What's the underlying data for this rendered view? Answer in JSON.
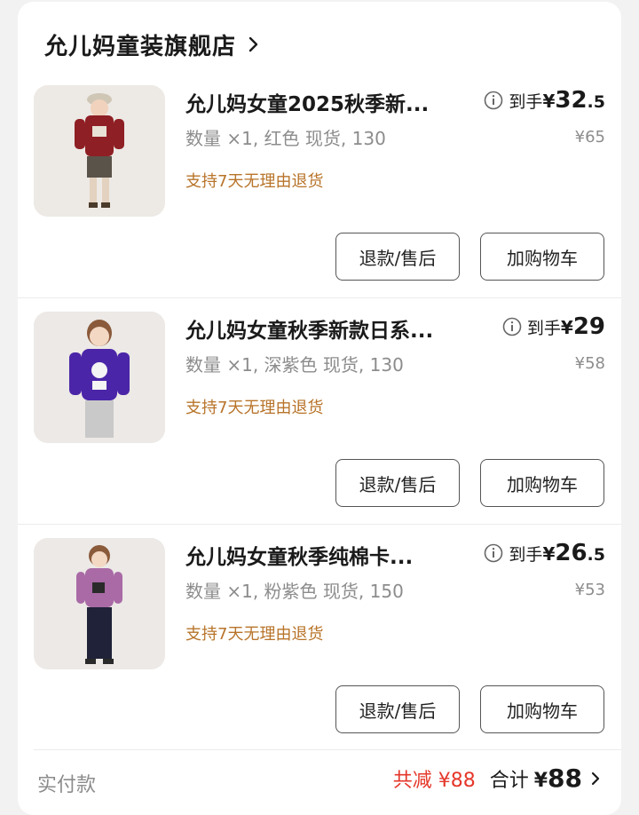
{
  "shop": {
    "name": "允儿妈童装旗舰店"
  },
  "items": [
    {
      "title": "允儿妈女童2025秋季新...",
      "specs": "数量 ×1, 红色 现货, 130",
      "policy": "支持7天无理由退货",
      "price_label": "到手",
      "price_currency": "¥",
      "price_int": "32",
      "price_dec": ".5",
      "original_price": "¥65",
      "refund_label": "退款/售后",
      "cart_label": "加购物车",
      "sweater_color": "#8e1f24"
    },
    {
      "title": "允儿妈女童秋季新款日系...",
      "specs": "数量 ×1, 深紫色 现货, 130",
      "policy": "支持7天无理由退货",
      "price_label": "到手",
      "price_currency": "¥",
      "price_int": "29",
      "price_dec": "",
      "original_price": "¥58",
      "refund_label": "退款/售后",
      "cart_label": "加购物车",
      "sweater_color": "#4b25a8"
    },
    {
      "title": "允儿妈女童秋季纯棉卡...",
      "specs": "数量 ×1, 粉紫色 现货, 150",
      "policy": "支持7天无理由退货",
      "price_label": "到手",
      "price_currency": "¥",
      "price_int": "26",
      "price_dec": ".5",
      "original_price": "¥53",
      "refund_label": "退款/售后",
      "cart_label": "加购物车",
      "sweater_color": "#a96aa6"
    }
  ],
  "footer": {
    "label": "实付款",
    "discount": "共减 ¥88",
    "total_label": "合计",
    "total_currency": "¥",
    "total_value": "88"
  },
  "colors": {
    "discount": "#e5372a",
    "policy": "#b8742a"
  }
}
